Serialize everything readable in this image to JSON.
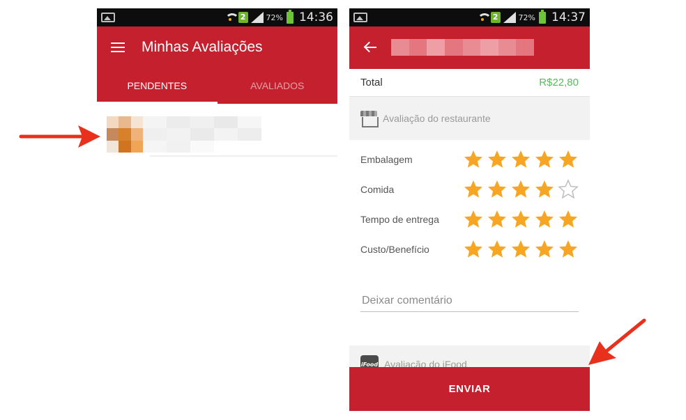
{
  "left_screen": {
    "status_bar": {
      "badge": "2",
      "battery": "72%",
      "time": "14:36"
    },
    "app_bar": {
      "title": "Minhas Avaliações"
    },
    "tabs": [
      {
        "label": "PENDENTES",
        "active": true
      },
      {
        "label": "AVALIADOS",
        "active": false
      }
    ],
    "list": {
      "items": 1
    }
  },
  "right_screen": {
    "status_bar": {
      "badge": "2",
      "battery": "72%",
      "time": "14:37"
    },
    "total": {
      "label": "Total",
      "value": "R$22,80"
    },
    "restaurant_section": {
      "title": "Avaliação do restaurante",
      "icon": "store-icon"
    },
    "ratings": [
      {
        "label": "Embalagem",
        "stars": 5
      },
      {
        "label": "Comida",
        "stars": 4
      },
      {
        "label": "Tempo de entrega",
        "stars": 5
      },
      {
        "label": "Custo/Benefício",
        "stars": 5
      }
    ],
    "max_stars": 5,
    "comment": {
      "placeholder": "Deixar comentário",
      "value": ""
    },
    "ifood_section": {
      "title": "Avaliação do iFood",
      "icon": "ifood-icon",
      "icon_text": "iFood"
    },
    "send_button": {
      "label": "ENVIAR"
    }
  },
  "colors": {
    "primary_red": "#c4202e",
    "star_filled": "#f6a623",
    "star_empty": "#bdbdbd",
    "total_green": "#5cb85c",
    "annotation_arrow": "#e8301c"
  }
}
